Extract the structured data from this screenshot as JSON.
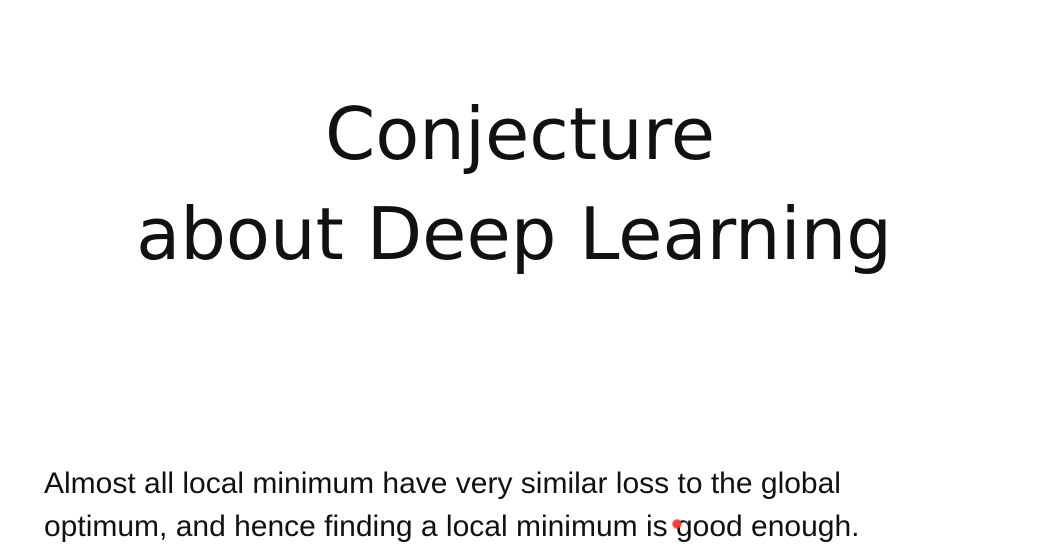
{
  "slide": {
    "title_lines": [
      "Conjecture",
      "about Deep Learning"
    ],
    "body_lines": [
      "Almost all local minimum have very similar loss to the global",
      "optimum, and hence finding a local minimum is good enough."
    ]
  }
}
